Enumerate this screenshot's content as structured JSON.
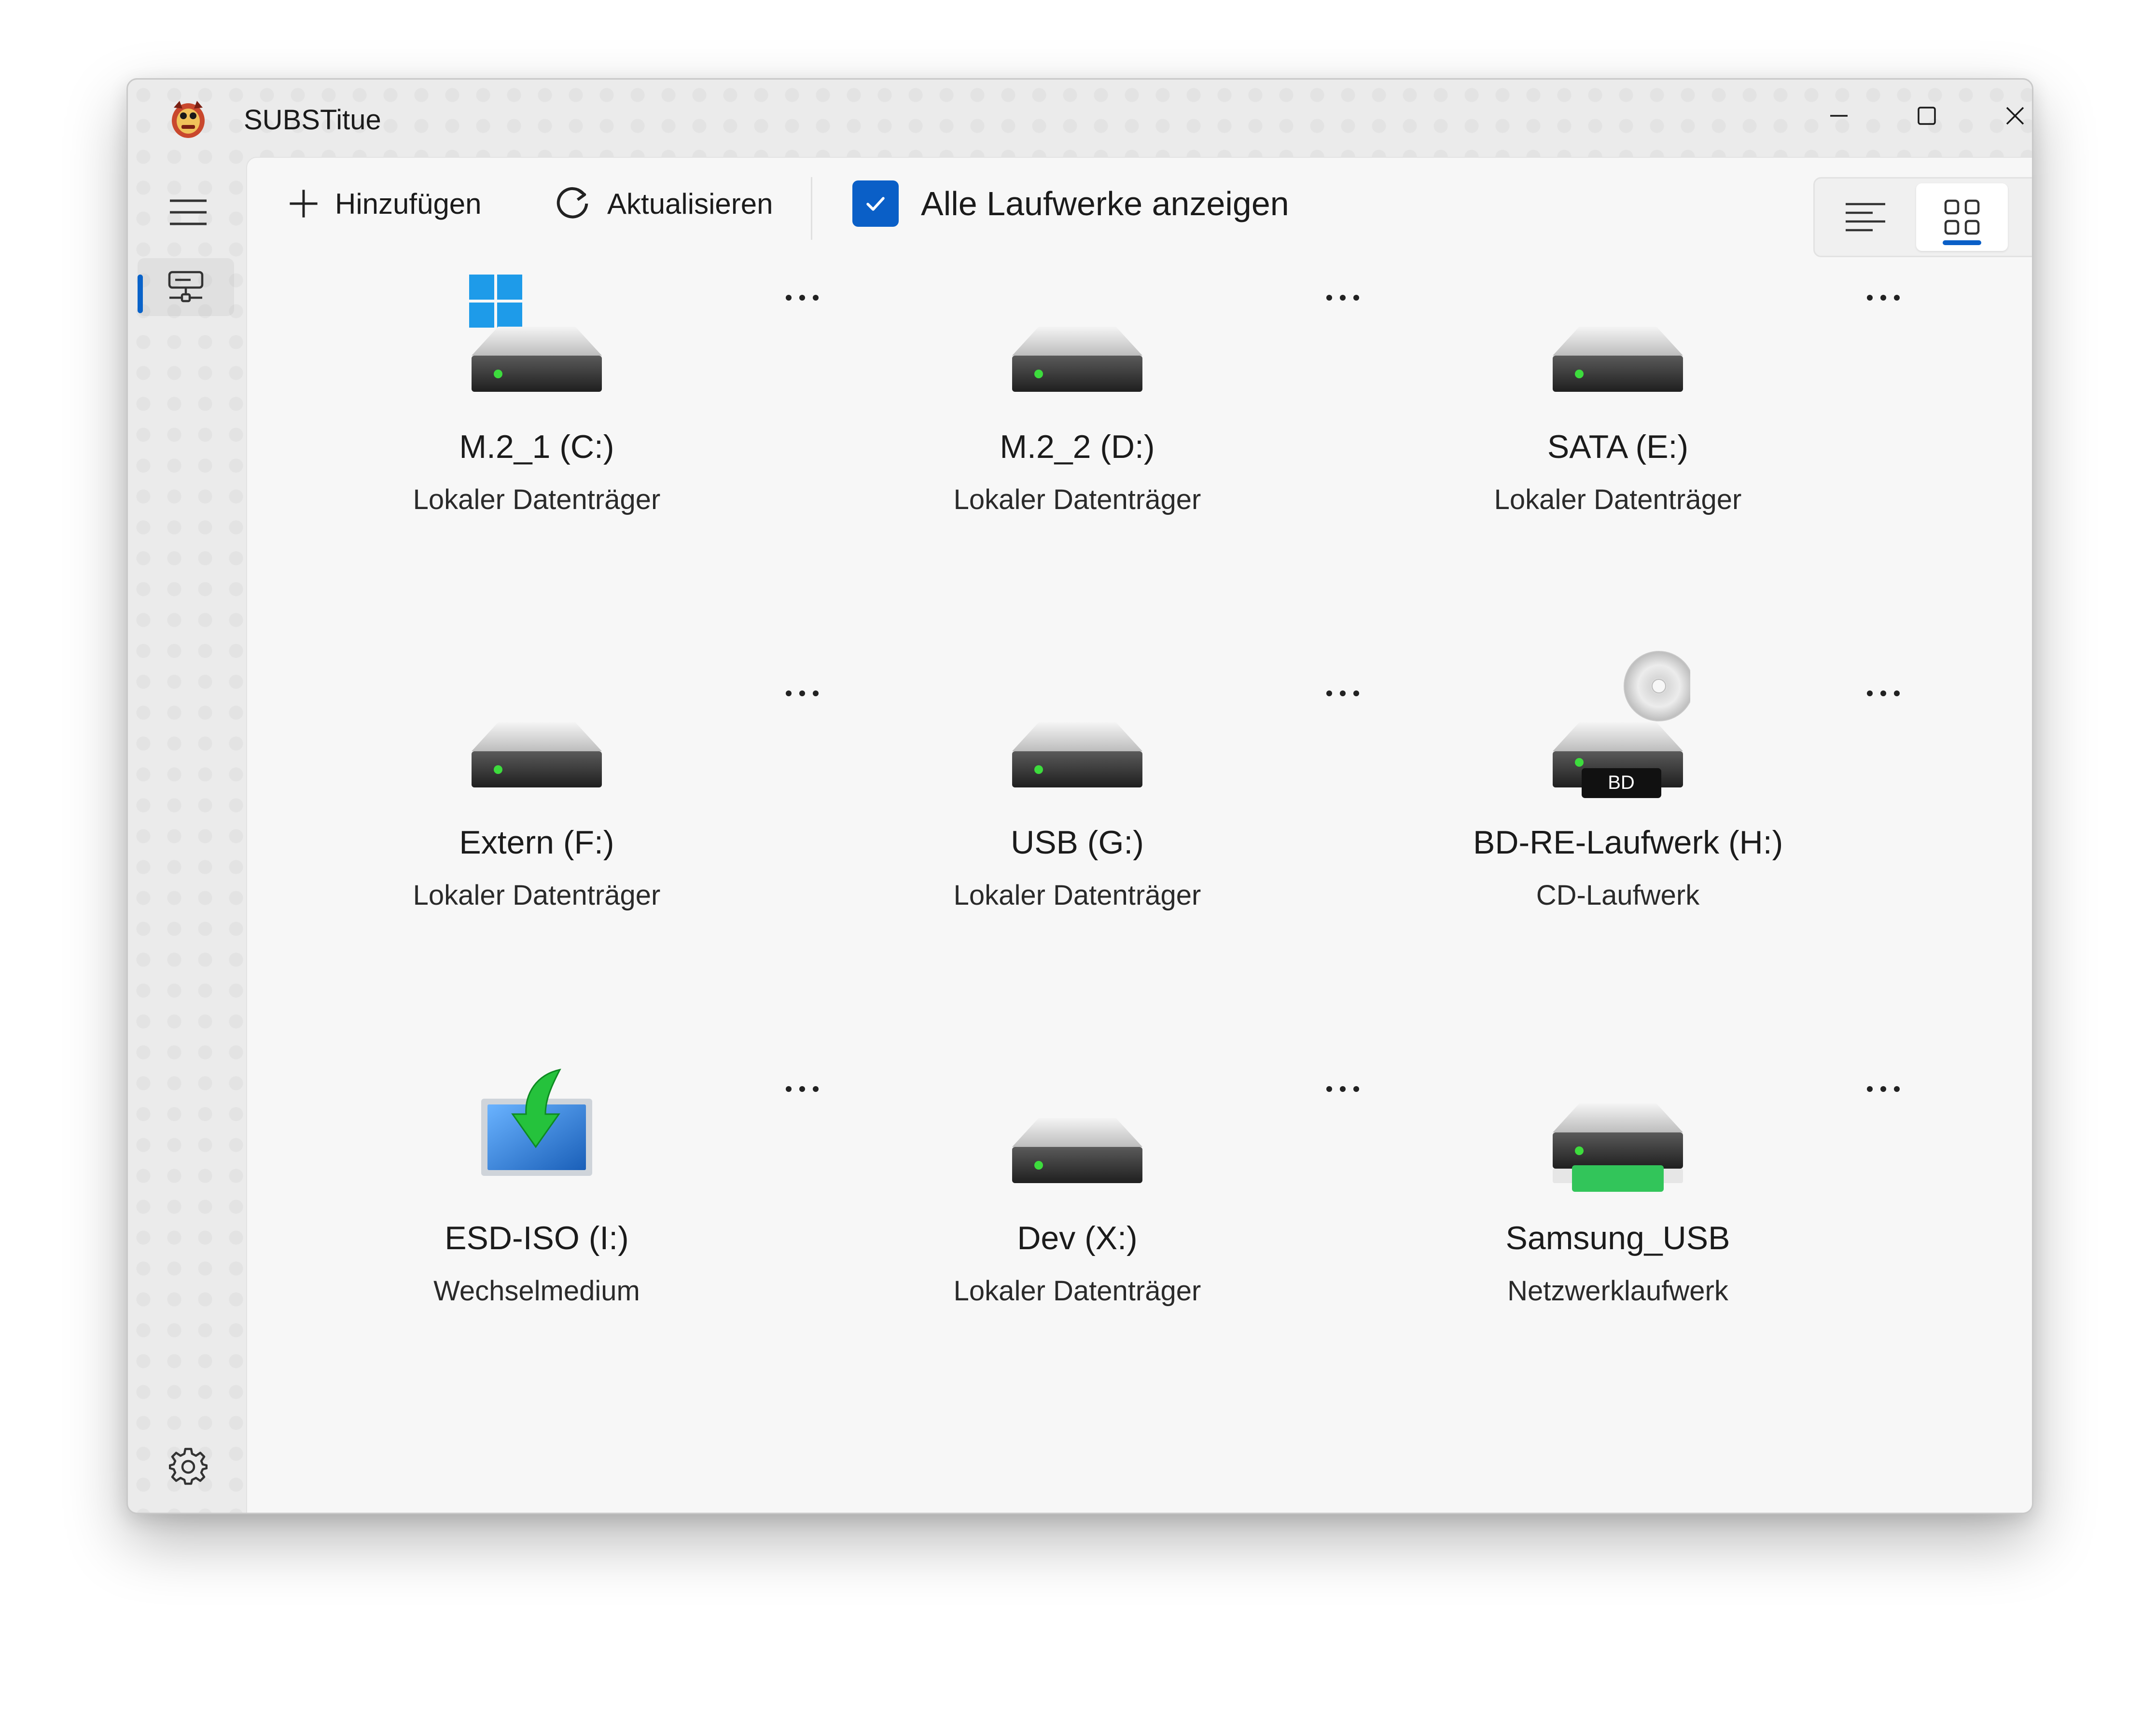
{
  "window": {
    "title": "SUBSTitue"
  },
  "toolbar": {
    "add_label": "Hinzufügen",
    "refresh_label": "Aktualisieren",
    "show_all_label": "Alle Laufwerke anzeigen",
    "show_all_checked": true,
    "active_view": "tiles"
  },
  "colors": {
    "accent": "#0a5fc7",
    "led": "#3ddc3d"
  },
  "drives": [
    {
      "name": "M.2_1 (C:)",
      "type": "Lokaler Datenträger",
      "icon": "system-drive-icon"
    },
    {
      "name": "M.2_2 (D:)",
      "type": "Lokaler Datenträger",
      "icon": "hard-drive-icon"
    },
    {
      "name": "SATA (E:)",
      "type": "Lokaler Datenträger",
      "icon": "hard-drive-icon"
    },
    {
      "name": "Extern (F:)",
      "type": "Lokaler Datenträger",
      "icon": "hard-drive-icon"
    },
    {
      "name": "USB (G:)",
      "type": "Lokaler Datenträger",
      "icon": "hard-drive-icon"
    },
    {
      "name": "BD-RE-Laufwerk (H:)",
      "type": "CD-Laufwerk",
      "icon": "bd-drive-icon",
      "badge": "BD"
    },
    {
      "name": "ESD-ISO (I:)",
      "type": "Wechselmedium",
      "icon": "removable-media-icon"
    },
    {
      "name": "Dev (X:)",
      "type": "Lokaler Datenträger",
      "icon": "hard-drive-icon"
    },
    {
      "name": "Samsung_USB",
      "type": "Netzwerklaufwerk",
      "icon": "network-drive-icon"
    }
  ]
}
